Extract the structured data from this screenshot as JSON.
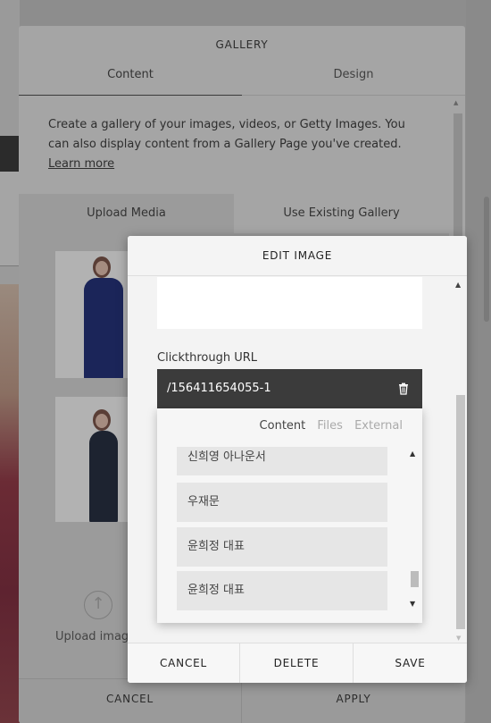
{
  "gallery": {
    "title": "GALLERY",
    "tabs": [
      {
        "label": "Content"
      },
      {
        "label": "Design"
      }
    ],
    "description": "Create a gallery of your images, videos, or Getty Images. You can also display content from a Gallery Page you've created.",
    "learn_more": "Learn more",
    "upload_media": "Upload Media",
    "use_existing": "Use Existing Gallery",
    "upload_image": "Upload image",
    "cancel": "CANCEL",
    "apply": "APPLY"
  },
  "edit_image": {
    "title": "EDIT IMAGE",
    "clickthrough_label": "Clickthrough URL",
    "clickthrough_value": "/156411654055-1",
    "cancel": "CANCEL",
    "delete": "DELETE",
    "save": "SAVE"
  },
  "link_picker": {
    "tabs": [
      {
        "label": "Content"
      },
      {
        "label": "Files"
      },
      {
        "label": "External"
      }
    ],
    "active_tab": "Content",
    "items": [
      {
        "label": "신희영 아나운서"
      },
      {
        "label": "우재문"
      },
      {
        "label": "윤희정 대표"
      },
      {
        "label": "윤희정 대표"
      }
    ]
  },
  "icons": {
    "trash": "trash-icon",
    "upload": "upload-arrow-icon",
    "scroll_up": "scroll-up-arrow-icon",
    "scroll_down": "scroll-down-arrow-icon"
  },
  "colors": {
    "overlay": "#8d8d8d",
    "url_field_bg": "#3b3b3b",
    "modal_bg": "#f3f3f3"
  }
}
